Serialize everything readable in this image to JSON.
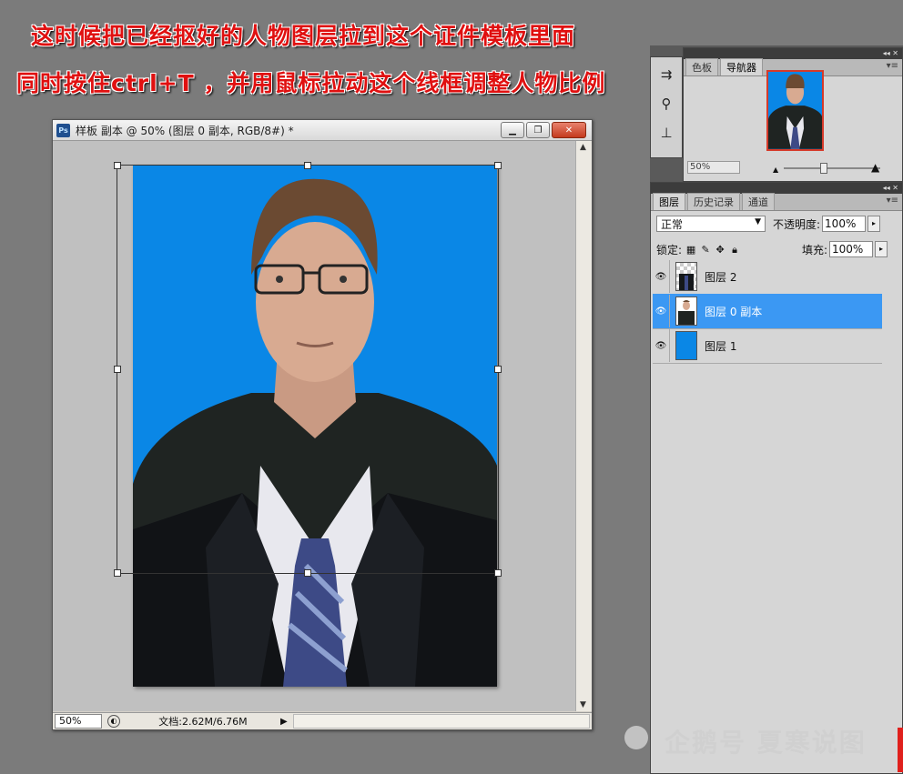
{
  "captions": {
    "line1": "这时候把已经抠好的人物图层拉到这个证件模板里面",
    "line2": "同时按住ctrl+T ，并用鼠标拉动这个线框调整人物比例"
  },
  "document": {
    "app_icon": "Ps",
    "title": "样板 副本 @ 50% (图层 0 副本, RGB/8#) *",
    "zoom": "50%",
    "doc_size": "文档:2.62M/6.76M"
  },
  "navigator": {
    "tabs": [
      "色板",
      "导航器"
    ],
    "active_tab": "导航器",
    "zoom": "50%"
  },
  "layers_panel": {
    "tabs": [
      "图层",
      "历史记录",
      "通道"
    ],
    "active_tab": "图层",
    "blend_mode": "正常",
    "opacity_label": "不透明度:",
    "opacity": "100%",
    "lock_label": "锁定:",
    "fill_label": "填充:",
    "fill": "100%",
    "layers": [
      {
        "name": "图层 2",
        "selected": false
      },
      {
        "name": "图层 0 副本",
        "selected": true
      },
      {
        "name": "图层 1",
        "selected": false
      }
    ]
  },
  "watermark": "企鹅号 夏寒说图",
  "colors": {
    "template_blue": "#0a87e6",
    "selection": "#3b98f3",
    "caption_red": "#e01010"
  }
}
